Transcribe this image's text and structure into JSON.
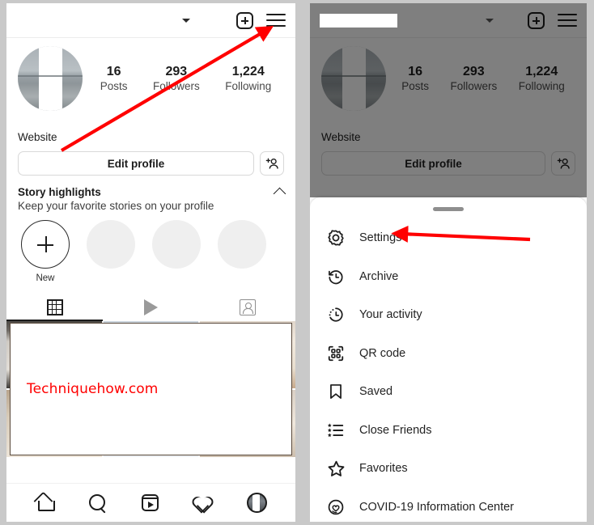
{
  "watermark": {
    "text": "Techniquehow.com",
    "color": "#ff0000"
  },
  "colors": {
    "accent_arrow": "#ff0000",
    "page_background": "#c9c9c9",
    "dim_overlay": "rgba(0,0,0,0.50)"
  },
  "left_panel": {
    "topbar": {
      "username": "",
      "chevron_icon": "chevron-down-icon",
      "add_icon": "plus-box-icon",
      "menu_icon": "hamburger-menu-icon"
    },
    "profile": {
      "avatar_icon": "profile-avatar",
      "name": "",
      "website_label": "Website",
      "stats": [
        {
          "num": "16",
          "lbl": "Posts"
        },
        {
          "num": "293",
          "lbl": "Followers"
        },
        {
          "num": "1,224",
          "lbl": "Following"
        }
      ]
    },
    "buttons": {
      "edit_profile": "Edit profile",
      "add_person_icon": "add-person-icon"
    },
    "story_highlights": {
      "title": "Story highlights",
      "subtitle": "Keep your favorite stories on your profile",
      "collapse_icon": "chevron-up-icon",
      "new_label": "New"
    },
    "tabs": [
      {
        "name": "grid",
        "icon": "grid-icon",
        "active": true
      },
      {
        "name": "reels",
        "icon": "play-icon",
        "active": false
      },
      {
        "name": "tagged",
        "icon": "tagged-icon",
        "active": false
      }
    ],
    "bottom_nav": [
      {
        "name": "home",
        "icon": "home-icon"
      },
      {
        "name": "search",
        "icon": "search-icon"
      },
      {
        "name": "reels",
        "icon": "reels-icon"
      },
      {
        "name": "activity",
        "icon": "heart-icon"
      },
      {
        "name": "profile",
        "icon": "profile-avatar-icon"
      }
    ]
  },
  "right_panel": {
    "topbar": {
      "username": "",
      "chevron_icon": "chevron-down-icon",
      "add_icon": "plus-box-icon",
      "menu_icon": "hamburger-menu-icon"
    },
    "profile": {
      "name": "",
      "website_label": "Website",
      "stats": [
        {
          "num": "16",
          "lbl": "Posts"
        },
        {
          "num": "293",
          "lbl": "Followers"
        },
        {
          "num": "1,224",
          "lbl": "Following"
        }
      ]
    },
    "buttons": {
      "edit_profile": "Edit profile",
      "add_person_icon": "add-person-icon"
    },
    "sheet": {
      "handle_icon": "drag-handle",
      "menu_items": [
        {
          "label": "Settings",
          "icon": "gear-icon"
        },
        {
          "label": "Archive",
          "icon": "archive-clock-icon"
        },
        {
          "label": "Your activity",
          "icon": "activity-clock-icon"
        },
        {
          "label": "QR code",
          "icon": "qr-code-icon"
        },
        {
          "label": "Saved",
          "icon": "bookmark-icon"
        },
        {
          "label": "Close Friends",
          "icon": "close-friends-list-icon"
        },
        {
          "label": "Favorites",
          "icon": "star-icon"
        },
        {
          "label": "COVID-19 Information Center",
          "icon": "covid-info-icon"
        }
      ]
    }
  },
  "annotations": [
    {
      "name": "arrow-to-hamburger-menu",
      "color": "#ff0000"
    },
    {
      "name": "arrow-to-settings",
      "color": "#ff0000"
    }
  ]
}
